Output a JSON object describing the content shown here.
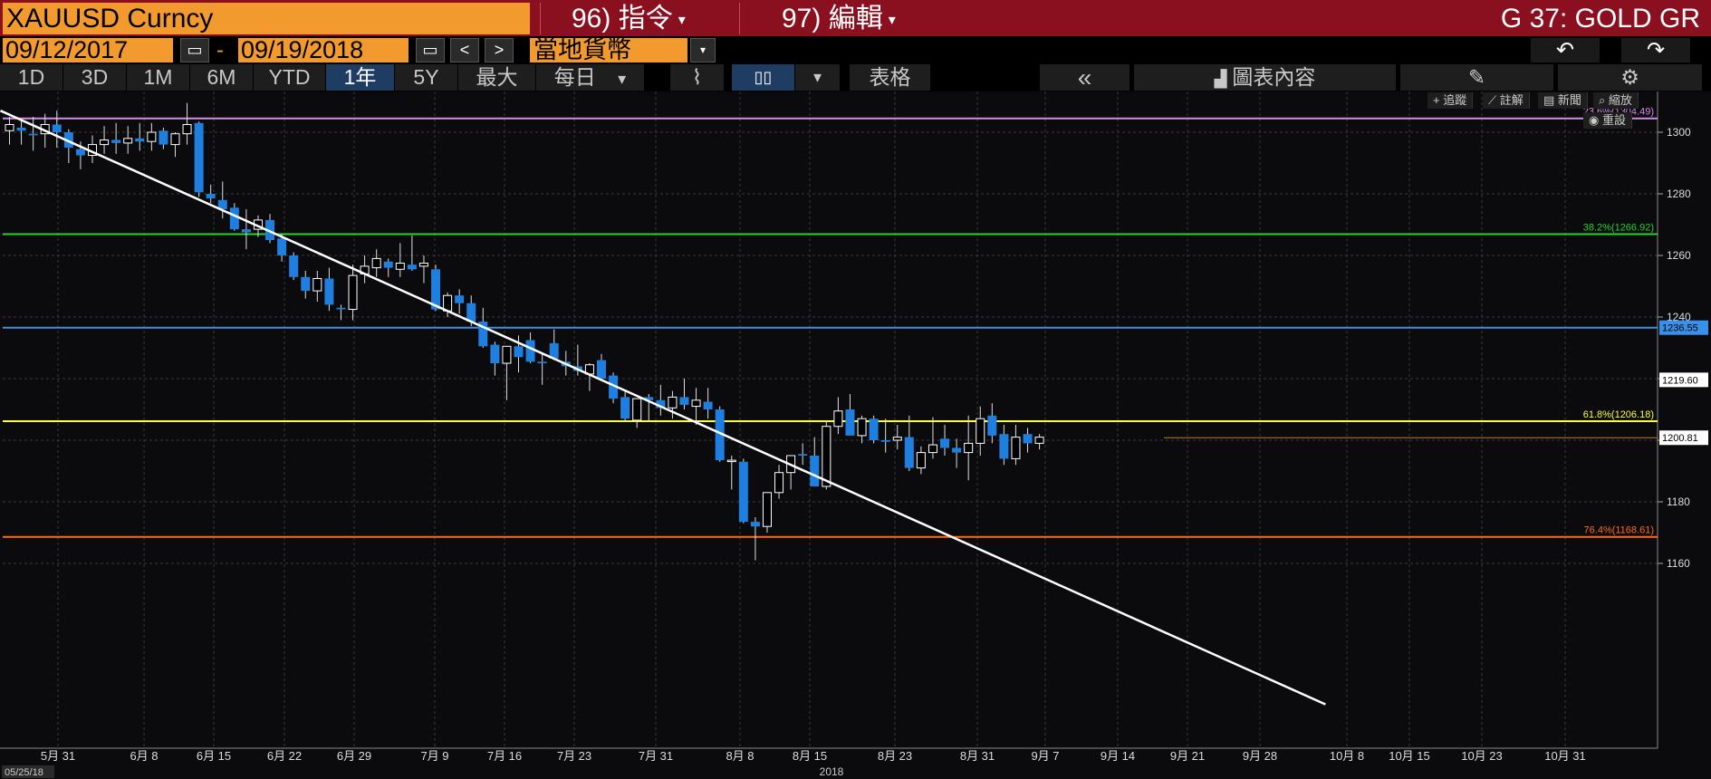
{
  "header": {
    "ticker": "XAUUSD Curncy",
    "menu_command": "96) 指令",
    "menu_edit": "97) 編輯",
    "title": "G 37: GOLD GR",
    "dropdown_arrow": "▾"
  },
  "dates": {
    "start": "09/12/2017",
    "sep": "-",
    "end": "09/19/2018",
    "currency": "當地貨幣",
    "prev_icon": "chevron-left-icon",
    "next_icon": "chevron-right-icon",
    "prev_glyph": "<",
    "next_glyph": ">",
    "cal_glyph": "▭",
    "undo_glyph": "↶",
    "redo_glyph": "↷"
  },
  "toolbar": {
    "periods": [
      "1D",
      "3D",
      "1M",
      "6M",
      "YTD",
      "1年",
      "5Y",
      "最大"
    ],
    "active_period": "1年",
    "frequency": "每日",
    "table": "表格",
    "collapse_glyph": "«",
    "chart_content": "圖表內容",
    "line_glyph": "⌇",
    "candle_glyph": "▯▯",
    "edit_glyph": "✎",
    "gear_glyph": "⚙"
  },
  "mini_toolbar": {
    "track": "追蹤",
    "annotate": "註解",
    "news": "新聞",
    "zoom": "縮放",
    "reset": "重設"
  },
  "colors": {
    "header_bg": "#8a0f1f",
    "accent": "#f29a2e",
    "up": "#ffffff",
    "down": "#1e7fe0",
    "fib_236": "#d58ce8",
    "fib_382": "#27d427",
    "fib_618": "#ffff33",
    "fib_764": "#ff6a1a",
    "level_blue": "#3a8fe8",
    "trendline": "#ffffff"
  },
  "chart_data": {
    "type": "candlestick",
    "y_ticks": [
      1160,
      1180,
      1200,
      1220,
      1240,
      1260,
      1280,
      1300
    ],
    "ylim": [
      1140,
      1310
    ],
    "x_ticks": [
      "5月 31",
      "6月 8",
      "6月 15",
      "6月 22",
      "6月 29",
      "7月 9",
      "7月 16",
      "7月 23",
      "7月 31",
      "8月 8",
      "8月 15",
      "8月 23",
      "8月 31",
      "9月 7",
      "9月 14",
      "9月 21",
      "9月 28",
      "10月 8",
      "10月 15",
      "10月 23",
      "10月 31"
    ],
    "start_label": "05/25/18",
    "year_label": "2018",
    "fib_levels": [
      {
        "label": "23.6%(1304.49)",
        "value": 1304.49
      },
      {
        "label": "38.2%(1266.92)",
        "value": 1266.92
      },
      {
        "label": "61.8%(1206.18)",
        "value": 1206.18
      },
      {
        "label": "76.4%(1168.61)",
        "value": 1168.61
      }
    ],
    "blue_level": {
      "label": "1236.55",
      "value": 1236.55
    },
    "price_labels": [
      {
        "label": "1219.60",
        "value": 1219.6
      },
      {
        "label": "1200.81",
        "value": 1200.81
      }
    ],
    "trendline": [
      {
        "i": 0,
        "v": 1307
      },
      {
        "i": 84,
        "v": 1141
      }
    ],
    "candles": [
      [
        1300.5,
        1305,
        1296,
        1302.5
      ],
      [
        1301.5,
        1304,
        1296,
        1300.5
      ],
      [
        1299.5,
        1305,
        1294,
        1299
      ],
      [
        1299.5,
        1306,
        1295,
        1302.5
      ],
      [
        1302.5,
        1307,
        1295,
        1300
      ],
      [
        1300,
        1301,
        1290,
        1295
      ],
      [
        1294.5,
        1297,
        1288,
        1292.5
      ],
      [
        1292.5,
        1299,
        1290,
        1296
      ],
      [
        1296,
        1302,
        1293,
        1297.5
      ],
      [
        1297.5,
        1303,
        1293,
        1296.5
      ],
      [
        1296.5,
        1302,
        1293,
        1298
      ],
      [
        1298,
        1303,
        1294,
        1297
      ],
      [
        1297,
        1303,
        1294,
        1300
      ],
      [
        1300.5,
        1301.5,
        1294.5,
        1296
      ],
      [
        1296,
        1300,
        1292,
        1299.5
      ],
      [
        1299.5,
        1309.5,
        1296,
        1302.5
      ],
      [
        1303,
        1303.5,
        1279,
        1280.5
      ],
      [
        1280,
        1283,
        1277,
        1278.5
      ],
      [
        1278,
        1284,
        1272,
        1275
      ],
      [
        1275.5,
        1277,
        1268,
        1268.5
      ],
      [
        1268.5,
        1275,
        1262,
        1267.5
      ],
      [
        1268.5,
        1273,
        1266,
        1271.5
      ],
      [
        1271.5,
        1273.5,
        1264,
        1265
      ],
      [
        1265.5,
        1267,
        1258,
        1260
      ],
      [
        1260,
        1261,
        1252,
        1253
      ],
      [
        1253,
        1255,
        1246,
        1248.5
      ],
      [
        1248.5,
        1255,
        1245,
        1252.5
      ],
      [
        1252.5,
        1256,
        1242,
        1244
      ],
      [
        1243,
        1244,
        1239,
        1242.5
      ],
      [
        1242.5,
        1257,
        1239,
        1253.5
      ],
      [
        1254,
        1260,
        1251,
        1256.5
      ],
      [
        1256,
        1262,
        1253,
        1259
      ],
      [
        1258,
        1259,
        1253,
        1256
      ],
      [
        1255.5,
        1264,
        1253,
        1257.5
      ],
      [
        1257,
        1266.5,
        1255,
        1255.5
      ],
      [
        1256.5,
        1260,
        1251,
        1257.5
      ],
      [
        1255.5,
        1257,
        1242,
        1242.5
      ],
      [
        1242,
        1248,
        1240,
        1247
      ],
      [
        1247,
        1249,
        1241,
        1244.5
      ],
      [
        1244.5,
        1247,
        1237,
        1238.5
      ],
      [
        1238.5,
        1243,
        1230,
        1230.5
      ],
      [
        1231,
        1232,
        1221,
        1225
      ],
      [
        1225,
        1230,
        1213,
        1230.5
      ],
      [
        1230.5,
        1234,
        1222,
        1227
      ],
      [
        1232.5,
        1235,
        1225,
        1225.5
      ],
      [
        1225.5,
        1228,
        1218,
        1225
      ],
      [
        1231.5,
        1236,
        1226,
        1226.5
      ],
      [
        1225.5,
        1229,
        1221,
        1224
      ],
      [
        1224,
        1231,
        1221,
        1222.5
      ],
      [
        1221.5,
        1225,
        1216,
        1224.5
      ],
      [
        1226,
        1228,
        1221,
        1220
      ],
      [
        1221,
        1222,
        1212,
        1213.5
      ],
      [
        1214,
        1216,
        1206,
        1207
      ],
      [
        1206.5,
        1208,
        1204,
        1213.5
      ],
      [
        1214,
        1215,
        1206,
        1213
      ],
      [
        1213,
        1218,
        1208,
        1210.5
      ],
      [
        1210.5,
        1216,
        1207,
        1214
      ],
      [
        1214,
        1220,
        1210,
        1211.5
      ],
      [
        1211,
        1217,
        1205,
        1213
      ],
      [
        1212.5,
        1217,
        1207,
        1210
      ],
      [
        1210,
        1211,
        1193,
        1193.5
      ],
      [
        1193.5,
        1195,
        1184,
        1193.5
      ],
      [
        1193,
        1194,
        1173,
        1173.5
      ],
      [
        1173.5,
        1175,
        1161,
        1172
      ],
      [
        1172,
        1183,
        1170,
        1183
      ],
      [
        1183,
        1192,
        1181,
        1189.5
      ],
      [
        1189.5,
        1193,
        1184,
        1195
      ],
      [
        1195.5,
        1199,
        1192,
        1195
      ],
      [
        1195,
        1201,
        1187,
        1185
      ],
      [
        1185,
        1206.5,
        1184,
        1204.5
      ],
      [
        1204.5,
        1214,
        1202,
        1209.5
      ],
      [
        1210,
        1215,
        1202,
        1201.5
      ],
      [
        1201.5,
        1208,
        1199,
        1207
      ],
      [
        1207,
        1208,
        1199,
        1200
      ],
      [
        1200,
        1207,
        1196,
        1199.5
      ],
      [
        1200,
        1205,
        1197,
        1201
      ],
      [
        1201,
        1208,
        1190,
        1191
      ],
      [
        1191,
        1198,
        1189,
        1196
      ],
      [
        1196,
        1207.5,
        1194,
        1198.5
      ],
      [
        1200.5,
        1205,
        1195,
        1197.5
      ],
      [
        1197.5,
        1200.5,
        1191,
        1196
      ],
      [
        1196,
        1208,
        1187,
        1199
      ],
      [
        1199,
        1211,
        1195,
        1207
      ],
      [
        1208,
        1212,
        1199,
        1201.5
      ],
      [
        1202,
        1205,
        1192,
        1194
      ],
      [
        1194,
        1205,
        1192,
        1201
      ],
      [
        1202,
        1204,
        1196,
        1199
      ],
      [
        1199,
        1202,
        1197,
        1201
      ]
    ]
  }
}
